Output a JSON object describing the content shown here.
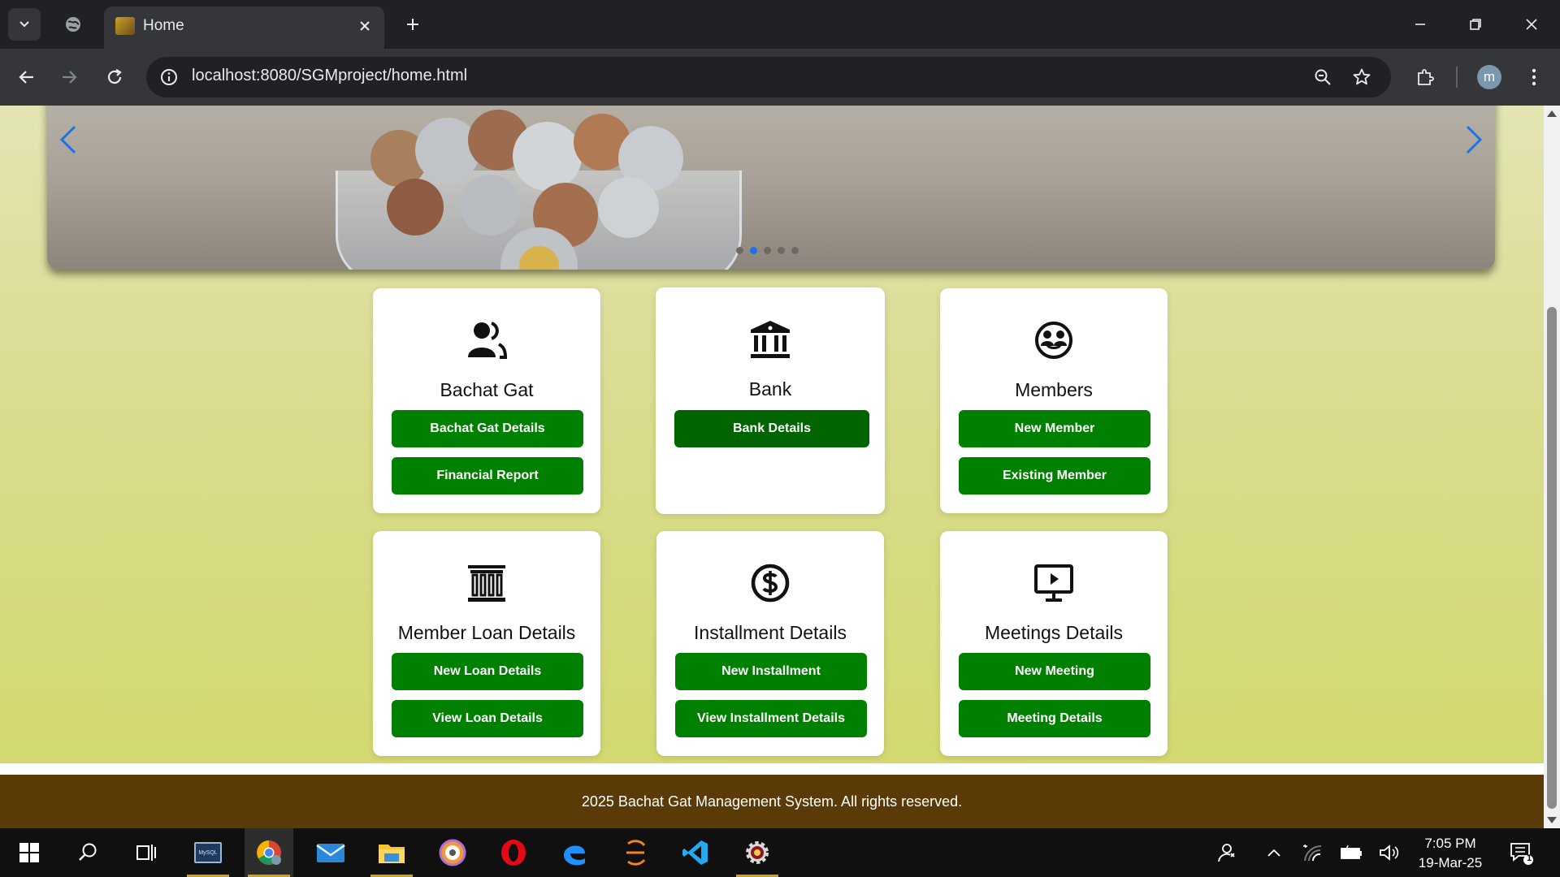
{
  "browser": {
    "tab_title": "Home",
    "url": "localhost:8080/SGMproject/home.html",
    "profile_initial": "m"
  },
  "carousel": {
    "slide_count": 5,
    "active_slide": 2
  },
  "cards": [
    {
      "title": "Bachat Gat",
      "icon": "users-icon",
      "buttons": [
        "Bachat Gat Details",
        "Financial Report"
      ]
    },
    {
      "title": "Bank",
      "icon": "bank-icon",
      "buttons": [
        "Bank Details"
      ]
    },
    {
      "title": "Members",
      "icon": "group-circle-icon",
      "buttons": [
        "New Member",
        "Existing Member"
      ]
    },
    {
      "title": "Member Loan Details",
      "icon": "building-columns-icon",
      "buttons": [
        "New Loan Details",
        "View Loan Details"
      ]
    },
    {
      "title": "Installment Details",
      "icon": "dollar-circle-icon",
      "buttons": [
        "New Installment",
        "View Installment Details"
      ]
    },
    {
      "title": "Meetings Details",
      "icon": "presentation-screen-icon",
      "buttons": [
        "New Meeting",
        "Meeting Details"
      ]
    }
  ],
  "footer": {
    "text": "2025 Bachat Gat Management System. All rights reserved."
  },
  "taskbar": {
    "time": "7:05 PM",
    "date": "19-Mar-25",
    "notification_count": "1",
    "mysql_label": "MySQL"
  },
  "colors": {
    "button_green": "#008000",
    "button_dark_green": "#006400",
    "footer_brown": "#5a3a06",
    "carousel_accent": "#1a73e8"
  }
}
